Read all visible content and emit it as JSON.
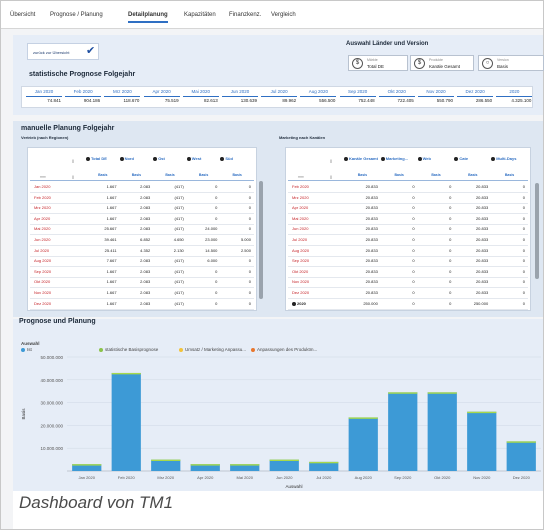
{
  "tabs": [
    "Übersicht",
    "Prognose / Planung",
    "Detailplanung",
    "Kapazitäten",
    "Finanzkenz.",
    "Vergleich"
  ],
  "active_tab": 2,
  "back_button": {
    "label": "zurück zur Übersicht"
  },
  "forecast": {
    "title": "statistische Prognose Folgejahr"
  },
  "selection": {
    "title": "Auswahl Länder und Version",
    "items": [
      {
        "icon": "dollar-icon",
        "label": "Märkte",
        "value": "Total DE"
      },
      {
        "icon": "dollar-icon",
        "label": "Produkte",
        "value": "Kanäle Gesamt"
      },
      {
        "icon": "circle-icon",
        "label": "Version",
        "value": "Basis"
      }
    ]
  },
  "months_row": [
    {
      "month": "Jan 2020",
      "value": "74.841"
    },
    {
      "month": "Feb 2020",
      "value": "904.186"
    },
    {
      "month": "Mrz 2020",
      "value": "118.670"
    },
    {
      "month": "Apr 2020",
      "value": "75.519"
    },
    {
      "month": "Mai 2020",
      "value": "82.613"
    },
    {
      "month": "Jun 2020",
      "value": "130.639"
    },
    {
      "month": "Jul 2020",
      "value": "89.962"
    },
    {
      "month": "Aug 2020",
      "value": "556.500"
    },
    {
      "month": "Sep 2020",
      "value": "752.448"
    },
    {
      "month": "Okt 2020",
      "value": "722.405"
    },
    {
      "month": "Nov 2020",
      "value": "550.790"
    },
    {
      "month": "Dez 2020",
      "value": "286.550"
    },
    {
      "month": "2020",
      "value": "4.325.100"
    }
  ],
  "manual": {
    "title": "manuelle Planung Folgejahr",
    "left": {
      "subtitle": "Vertrieb (nach Regionen)",
      "columns": [
        "Total DE",
        "Nord",
        "Ost",
        "West",
        "Süd"
      ],
      "basis": "Basis",
      "rows": [
        {
          "label": "Jan 2020",
          "values": [
            "1.667",
            "2.083",
            "(417)",
            "0",
            "0"
          ]
        },
        {
          "label": "Feb 2020",
          "values": [
            "1.667",
            "2.083",
            "(417)",
            "0",
            "0"
          ]
        },
        {
          "label": "Mrz 2020",
          "values": [
            "1.667",
            "2.083",
            "(417)",
            "0",
            "0"
          ]
        },
        {
          "label": "Apr 2020",
          "values": [
            "1.667",
            "2.083",
            "(417)",
            "0",
            "0"
          ]
        },
        {
          "label": "Mai 2020",
          "values": [
            "25.667",
            "2.083",
            "(417)",
            "24.000",
            "0"
          ]
        },
        {
          "label": "Jun 2020",
          "values": [
            "39.461",
            "6.852",
            "4.650",
            "23.000",
            "5.000"
          ]
        },
        {
          "label": "Jul 2020",
          "values": [
            "25.411",
            "4.352",
            "2.130",
            "14.500",
            "2.500"
          ]
        },
        {
          "label": "Aug 2020",
          "values": [
            "7.667",
            "2.083",
            "(417)",
            "6.000",
            "0"
          ]
        },
        {
          "label": "Sep 2020",
          "values": [
            "1.667",
            "2.083",
            "(417)",
            "0",
            "0"
          ]
        },
        {
          "label": "Okt 2020",
          "values": [
            "1.667",
            "2.083",
            "(417)",
            "0",
            "0"
          ]
        },
        {
          "label": "Nov 2020",
          "values": [
            "1.667",
            "2.083",
            "(417)",
            "0",
            "0"
          ]
        },
        {
          "label": "Dez 2020",
          "values": [
            "1.667",
            "2.083",
            "(417)",
            "0",
            "0"
          ]
        }
      ]
    },
    "right": {
      "subtitle": "Marketing nach Kanälen",
      "columns": [
        "Kanäle Gesamt",
        "Marketing...",
        "Web",
        "Cate",
        "Multi-Days"
      ],
      "basis": "Basis",
      "rows": [
        {
          "label": "Feb 2020",
          "values": [
            "20.833",
            "0",
            "0",
            "20.833",
            "0"
          ]
        },
        {
          "label": "Mrz 2020",
          "values": [
            "20.833",
            "0",
            "0",
            "20.833",
            "0"
          ]
        },
        {
          "label": "Apr 2020",
          "values": [
            "20.833",
            "0",
            "0",
            "20.833",
            "0"
          ]
        },
        {
          "label": "Mai 2020",
          "values": [
            "20.833",
            "0",
            "0",
            "20.833",
            "0"
          ]
        },
        {
          "label": "Jun 2020",
          "values": [
            "20.833",
            "0",
            "0",
            "20.833",
            "0"
          ]
        },
        {
          "label": "Jul 2020",
          "values": [
            "20.833",
            "0",
            "0",
            "20.833",
            "0"
          ]
        },
        {
          "label": "Aug 2020",
          "values": [
            "20.833",
            "0",
            "0",
            "20.833",
            "0"
          ]
        },
        {
          "label": "Sep 2020",
          "values": [
            "20.833",
            "0",
            "0",
            "20.833",
            "0"
          ]
        },
        {
          "label": "Okt 2020",
          "values": [
            "20.833",
            "0",
            "0",
            "20.833",
            "0"
          ]
        },
        {
          "label": "Nov 2020",
          "values": [
            "20.833",
            "0",
            "0",
            "20.833",
            "0"
          ]
        },
        {
          "label": "Dez 2020",
          "values": [
            "20.833",
            "0",
            "0",
            "20.833",
            "0"
          ]
        },
        {
          "label": "2020",
          "values": [
            "250.000",
            "0",
            "0",
            "250.000",
            "0"
          ]
        }
      ]
    }
  },
  "colors": {
    "accent": "#2f6fc3",
    "month_red": "#c41e24",
    "bar": "#3d9ad6",
    "bar_top": "#a8d94a"
  },
  "chart_section": {
    "title": "Prognose und Planung"
  },
  "chart_data": {
    "type": "bar",
    "legend_title": "Auswahl",
    "legend": [
      {
        "name": "Ist",
        "color": "#3d9ad6"
      },
      {
        "name": "statistische Basisprognose",
        "color": "#8bc34a"
      },
      {
        "name": "Umsatz / Marketing Anpassu...",
        "color": "#f2c33a"
      },
      {
        "name": "Anpassungen des Produktm...",
        "color": "#e8772e"
      }
    ],
    "categories": [
      "Jan 2020",
      "Feb 2020",
      "Mrz 2020",
      "Apr 2020",
      "Mai 2020",
      "Jun 2020",
      "Jul 2020",
      "Aug 2020",
      "Sep 2020",
      "Okt 2020",
      "Nov 2020",
      "Dez 2020"
    ],
    "values": [
      3000000,
      43000000,
      5000000,
      3000000,
      3000000,
      5000000,
      4000000,
      23500000,
      34500000,
      34500000,
      26000000,
      13000000
    ],
    "ylabel": "Basis",
    "xlabel": "Auswahl",
    "yticks": [
      "50.000.000",
      "40.000.000",
      "30.000.000",
      "20.000.000",
      "10.000.000"
    ],
    "ylim": [
      0,
      50000000
    ]
  },
  "caption": "Dashboard von TM1"
}
